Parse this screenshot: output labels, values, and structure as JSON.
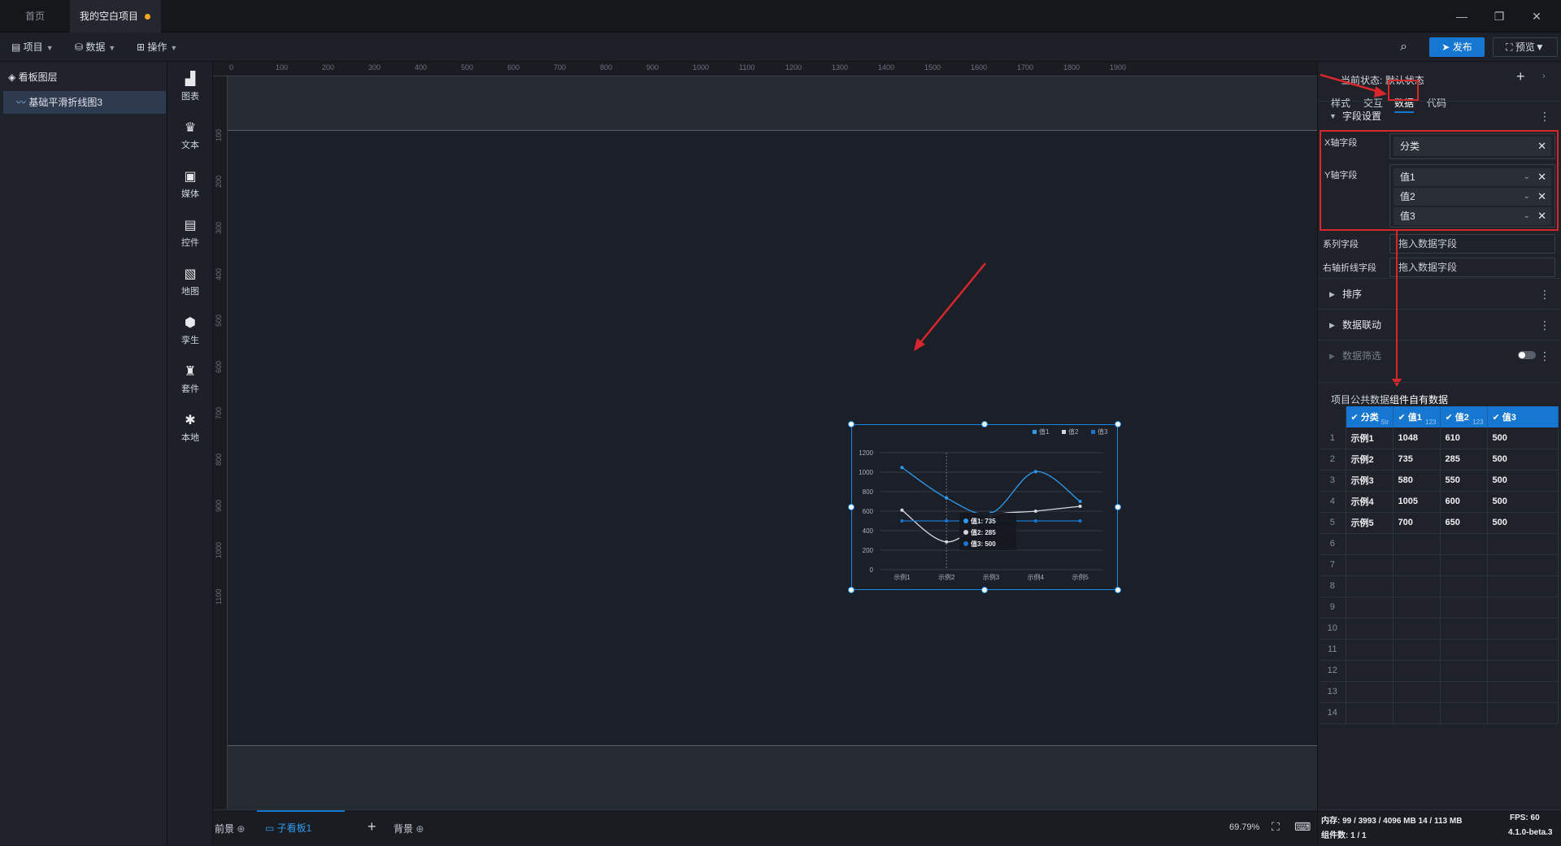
{
  "tabs": {
    "home": "首页",
    "project": "我的空白项目"
  },
  "menu": {
    "project": "项目",
    "data": "数据",
    "operate": "操作",
    "publish": "发布",
    "preview": "预览"
  },
  "layers": {
    "title": "看板图层",
    "item": "基础平滑折线图3"
  },
  "toolbox": [
    {
      "label": "图表",
      "icon": "bar-chart-icon"
    },
    {
      "label": "文本",
      "icon": "text-icon"
    },
    {
      "label": "媒体",
      "icon": "media-icon"
    },
    {
      "label": "控件",
      "icon": "control-icon"
    },
    {
      "label": "地图",
      "icon": "map-icon"
    },
    {
      "label": "孪生",
      "icon": "twin-icon"
    },
    {
      "label": "套件",
      "icon": "kit-icon"
    },
    {
      "label": "本地",
      "icon": "local-icon"
    }
  ],
  "ruler_top": [
    "0",
    "100",
    "200",
    "300",
    "400",
    "500",
    "600",
    "700",
    "800",
    "900",
    "1000",
    "1100",
    "1200",
    "1300",
    "1400",
    "1500",
    "1600",
    "1700",
    "1800",
    "1900"
  ],
  "ruler_left": [
    "100",
    "200",
    "300",
    "400",
    "500",
    "600",
    "700",
    "800",
    "900",
    "1000",
    "1100"
  ],
  "bottom": {
    "foreground": "前景",
    "board": "子看板1",
    "background": "背景",
    "zoom": "69.79%"
  },
  "right": {
    "state_label": "当前状态:",
    "state_value": "默认状态",
    "tabs": [
      "样式",
      "交互",
      "数据",
      "代码"
    ],
    "field_settings": "字段设置",
    "x_field_label": "X轴字段",
    "x_field_value": "分类",
    "y_field_label": "Y轴字段",
    "y_fields": [
      "值1",
      "值2",
      "值3"
    ],
    "series_label": "系列字段",
    "series_placeholder": "拖入数据字段",
    "right_axis_label": "右轴折线字段",
    "right_axis_placeholder": "拖入数据字段",
    "sections": [
      "排序",
      "数据联动",
      "数据筛选"
    ],
    "data_tabs": [
      "项目公共数据",
      "组件自有数据"
    ],
    "table_headers": [
      {
        "name": "分类",
        "type": "Str"
      },
      {
        "name": "值1",
        "type": "123"
      },
      {
        "name": "值2",
        "type": "123"
      },
      {
        "name": "值3",
        "type": ""
      }
    ],
    "table_rows": [
      [
        "1",
        "示例1",
        "1048",
        "610",
        "500"
      ],
      [
        "2",
        "示例2",
        "735",
        "285",
        "500"
      ],
      [
        "3",
        "示例3",
        "580",
        "550",
        "500"
      ],
      [
        "4",
        "示例4",
        "1005",
        "600",
        "500"
      ],
      [
        "5",
        "示例5",
        "700",
        "650",
        "500"
      ],
      [
        "6",
        "",
        "",
        "",
        ""
      ],
      [
        "7",
        "",
        "",
        "",
        ""
      ],
      [
        "8",
        "",
        "",
        "",
        ""
      ],
      [
        "9",
        "",
        "",
        "",
        ""
      ],
      [
        "10",
        "",
        "",
        "",
        ""
      ],
      [
        "11",
        "",
        "",
        "",
        ""
      ],
      [
        "12",
        "",
        "",
        "",
        ""
      ],
      [
        "13",
        "",
        "",
        "",
        ""
      ],
      [
        "14",
        "",
        "",
        "",
        ""
      ]
    ],
    "memory": "内存: 99 / 3993 / 4096 MB 14 / 113 MB",
    "fps": "FPS: 60",
    "components": "组件数: 1 / 1",
    "version": "4.1.0-beta.3"
  },
  "chart_data": {
    "type": "line",
    "categories": [
      "示例1",
      "示例2",
      "示例3",
      "示例4",
      "示例5"
    ],
    "series": [
      {
        "name": "值1",
        "values": [
          1048,
          735,
          580,
          1005,
          700
        ],
        "color": "#2e9bf0"
      },
      {
        "name": "值2",
        "values": [
          610,
          285,
          550,
          600,
          650
        ],
        "color": "#d4d8de"
      },
      {
        "name": "值3",
        "values": [
          500,
          500,
          500,
          500,
          500
        ],
        "color": "#1677d2"
      }
    ],
    "yticks": [
      "0",
      "200",
      "400",
      "600",
      "800",
      "1000",
      "1200"
    ],
    "ylim": [
      0,
      1200
    ],
    "legend": "top-right",
    "tooltip": {
      "lines": [
        "值1:  735",
        "值2:  285",
        "值3:  500"
      ]
    }
  },
  "colors": {
    "accent": "#1677d2",
    "annotation": "#d8262d"
  }
}
